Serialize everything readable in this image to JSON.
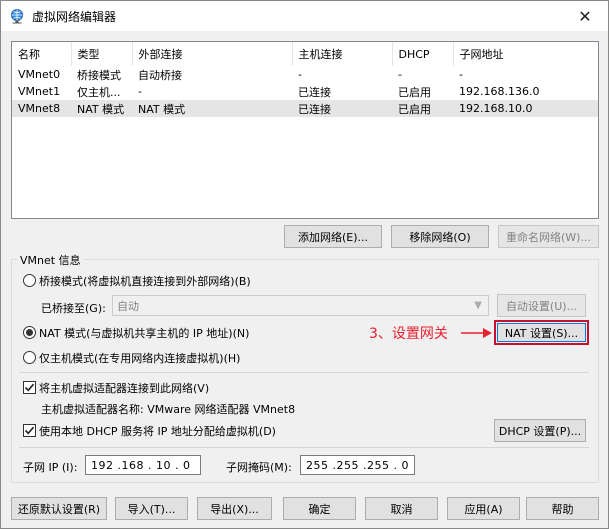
{
  "window": {
    "title": "虚拟网络编辑器",
    "close_glyph": "✕"
  },
  "network_list": {
    "columns": [
      "名称",
      "类型",
      "外部连接",
      "主机连接",
      "DHCP",
      "子网地址"
    ],
    "rows": [
      [
        "VMnet0",
        "桥接模式",
        "自动桥接",
        "-",
        "-",
        "-"
      ],
      [
        "VMnet1",
        "仅主机...",
        "-",
        "已连接",
        "已启用",
        "192.168.136.0"
      ],
      [
        "VMnet8",
        "NAT 模式",
        "NAT 模式",
        "已连接",
        "已启用",
        "192.168.10.0"
      ]
    ],
    "selected_index": 2
  },
  "list_buttons": {
    "add": "添加网络(E)...",
    "remove": "移除网络(O)",
    "rename": "重命名网络(W)..."
  },
  "vmnet_info": {
    "legend": "VMnet 信息",
    "bridged_label": "桥接模式(将虚拟机直接连接到外部网络)(B)",
    "bridged_to_label": "已桥接至(G):",
    "bridged_to_value": "自动",
    "auto_settings": "自动设置(U)...",
    "nat_label": "NAT 模式(与虚拟机共享主机的 IP 地址)(N)",
    "nat_settings": "NAT 设置(S)...",
    "hostonly_label": "仅主机模式(在专用网络内连接虚拟机)(H)",
    "selected_mode": "nat",
    "connect_adapter_label": "将主机虚拟适配器连接到此网络(V)",
    "connect_adapter_checked": true,
    "adapter_name_label": "主机虚拟适配器名称: VMware 网络适配器 VMnet8",
    "dhcp_label": "使用本地 DHCP 服务将 IP 地址分配给虚拟机(D)",
    "dhcp_checked": true,
    "dhcp_settings": "DHCP 设置(P)...",
    "subnet_ip_label": "子网 IP (I):",
    "subnet_ip_value": "192 .168 . 10 . 0",
    "subnet_mask_label": "子网掩码(M):",
    "subnet_mask_value": "255 .255 .255 . 0"
  },
  "annotation": {
    "text": "3、设置网关",
    "color": "#e8212f"
  },
  "footer_buttons": {
    "restore": "还原默认设置(R)",
    "import": "导入(T)...",
    "export": "导出(X)...",
    "ok": "确定",
    "cancel": "取消",
    "apply": "应用(A)",
    "help": "帮助"
  }
}
